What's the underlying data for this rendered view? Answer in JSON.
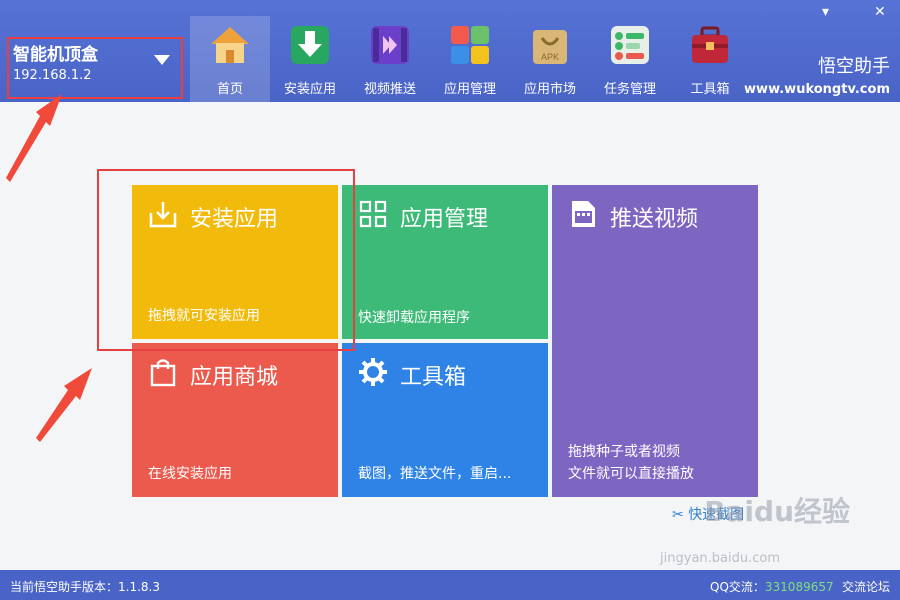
{
  "window": {
    "menu_glyph": "▾",
    "close_glyph": "✕"
  },
  "device": {
    "name": "智能机顶盒",
    "ip": "192.168.1.2"
  },
  "nav": {
    "items": [
      {
        "label": "首页",
        "icon": "home-icon",
        "active": true
      },
      {
        "label": "安装应用",
        "icon": "install-icon"
      },
      {
        "label": "视频推送",
        "icon": "video-push-icon"
      },
      {
        "label": "应用管理",
        "icon": "app-manage-icon"
      },
      {
        "label": "应用市场",
        "icon": "apk-market-icon"
      },
      {
        "label": "任务管理",
        "icon": "task-icon"
      },
      {
        "label": "工具箱",
        "icon": "toolbox-icon"
      }
    ]
  },
  "brand": {
    "name": "悟空助手",
    "url": "www.wukongtv.com"
  },
  "tiles": {
    "install": {
      "title": "安装应用",
      "sub": "拖拽就可安装应用",
      "color": "#f2bb0c"
    },
    "manage": {
      "title": "应用管理",
      "sub": "快速卸载应用程序",
      "color": "#3dba78"
    },
    "push": {
      "title": "推送视频",
      "sub1": "拖拽种子或者视频",
      "sub2": "文件就可以直接播放",
      "color": "#7d66c2"
    },
    "store": {
      "title": "应用商城",
      "sub": "在线安装应用",
      "color": "#ec5a4d"
    },
    "tools": {
      "title": "工具箱",
      "sub": "截图，推送文件，重启...",
      "color": "#2f83e6"
    }
  },
  "quick_capture": "快速截图",
  "watermark": {
    "text": "Baidu经验",
    "url": "jingyan.baidu.com"
  },
  "status": {
    "version": "当前悟空助手版本：1.1.8.3",
    "qq_label": "QQ交流：",
    "qq_number": "331089657",
    "forum": "交流论坛"
  },
  "colors": {
    "topbar": "#4a63c6",
    "annotation_red": "#e84040"
  }
}
